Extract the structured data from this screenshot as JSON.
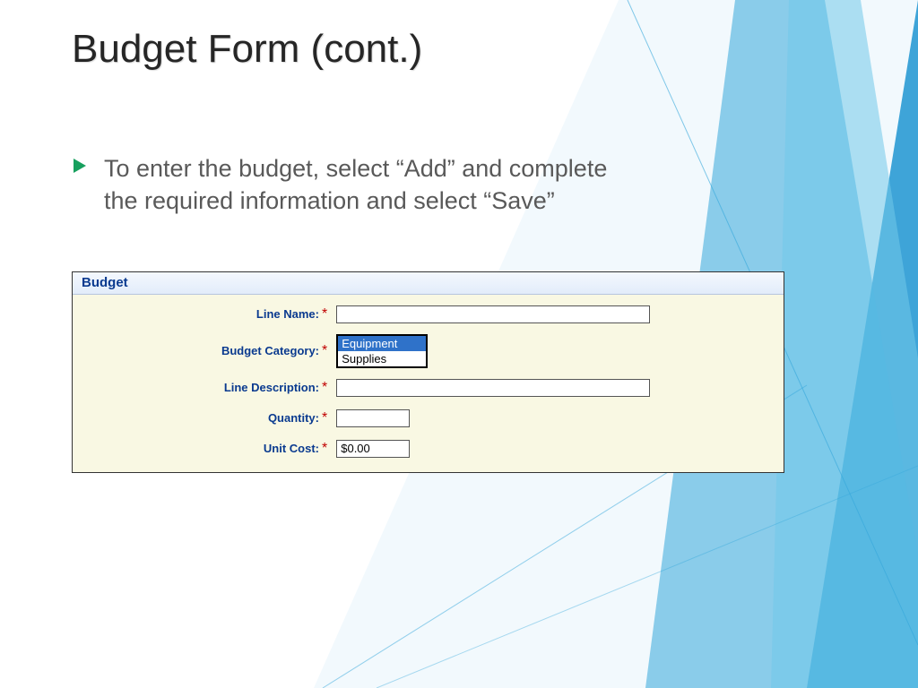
{
  "slide": {
    "title": "Budget Form (cont.)",
    "bullet": "To enter the budget, select “Add” and complete the required information and select “Save”"
  },
  "form": {
    "panel_title": "Budget",
    "fields": {
      "line_name": {
        "label": "Line Name:",
        "value": ""
      },
      "budget_category": {
        "label": "Budget Category:",
        "options": [
          "Equipment",
          "Supplies"
        ],
        "selected": "Equipment"
      },
      "line_description": {
        "label": "Line Description:",
        "value": ""
      },
      "quantity": {
        "label": "Quantity:",
        "value": ""
      },
      "unit_cost": {
        "label": "Unit Cost:",
        "value": "$0.00"
      }
    },
    "required_marker": "*"
  }
}
